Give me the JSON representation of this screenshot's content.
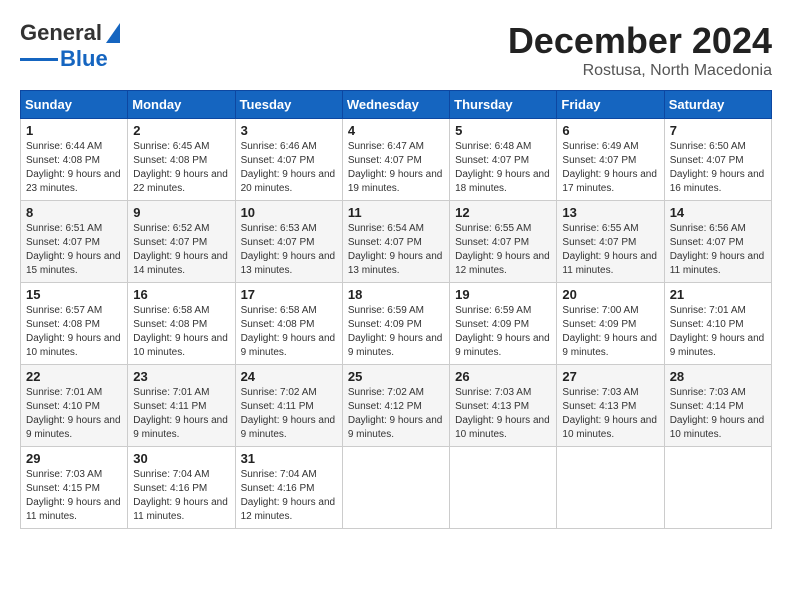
{
  "header": {
    "logo_general": "General",
    "logo_blue": "Blue",
    "month": "December 2024",
    "location": "Rostusa, North Macedonia"
  },
  "weekdays": [
    "Sunday",
    "Monday",
    "Tuesday",
    "Wednesday",
    "Thursday",
    "Friday",
    "Saturday"
  ],
  "weeks": [
    [
      {
        "day": "1",
        "sunrise": "6:44 AM",
        "sunset": "4:08 PM",
        "daylight": "9 hours and 23 minutes."
      },
      {
        "day": "2",
        "sunrise": "6:45 AM",
        "sunset": "4:08 PM",
        "daylight": "9 hours and 22 minutes."
      },
      {
        "day": "3",
        "sunrise": "6:46 AM",
        "sunset": "4:07 PM",
        "daylight": "9 hours and 20 minutes."
      },
      {
        "day": "4",
        "sunrise": "6:47 AM",
        "sunset": "4:07 PM",
        "daylight": "9 hours and 19 minutes."
      },
      {
        "day": "5",
        "sunrise": "6:48 AM",
        "sunset": "4:07 PM",
        "daylight": "9 hours and 18 minutes."
      },
      {
        "day": "6",
        "sunrise": "6:49 AM",
        "sunset": "4:07 PM",
        "daylight": "9 hours and 17 minutes."
      },
      {
        "day": "7",
        "sunrise": "6:50 AM",
        "sunset": "4:07 PM",
        "daylight": "9 hours and 16 minutes."
      }
    ],
    [
      {
        "day": "8",
        "sunrise": "6:51 AM",
        "sunset": "4:07 PM",
        "daylight": "9 hours and 15 minutes."
      },
      {
        "day": "9",
        "sunrise": "6:52 AM",
        "sunset": "4:07 PM",
        "daylight": "9 hours and 14 minutes."
      },
      {
        "day": "10",
        "sunrise": "6:53 AM",
        "sunset": "4:07 PM",
        "daylight": "9 hours and 13 minutes."
      },
      {
        "day": "11",
        "sunrise": "6:54 AM",
        "sunset": "4:07 PM",
        "daylight": "9 hours and 13 minutes."
      },
      {
        "day": "12",
        "sunrise": "6:55 AM",
        "sunset": "4:07 PM",
        "daylight": "9 hours and 12 minutes."
      },
      {
        "day": "13",
        "sunrise": "6:55 AM",
        "sunset": "4:07 PM",
        "daylight": "9 hours and 11 minutes."
      },
      {
        "day": "14",
        "sunrise": "6:56 AM",
        "sunset": "4:07 PM",
        "daylight": "9 hours and 11 minutes."
      }
    ],
    [
      {
        "day": "15",
        "sunrise": "6:57 AM",
        "sunset": "4:08 PM",
        "daylight": "9 hours and 10 minutes."
      },
      {
        "day": "16",
        "sunrise": "6:58 AM",
        "sunset": "4:08 PM",
        "daylight": "9 hours and 10 minutes."
      },
      {
        "day": "17",
        "sunrise": "6:58 AM",
        "sunset": "4:08 PM",
        "daylight": "9 hours and 9 minutes."
      },
      {
        "day": "18",
        "sunrise": "6:59 AM",
        "sunset": "4:09 PM",
        "daylight": "9 hours and 9 minutes."
      },
      {
        "day": "19",
        "sunrise": "6:59 AM",
        "sunset": "4:09 PM",
        "daylight": "9 hours and 9 minutes."
      },
      {
        "day": "20",
        "sunrise": "7:00 AM",
        "sunset": "4:09 PM",
        "daylight": "9 hours and 9 minutes."
      },
      {
        "day": "21",
        "sunrise": "7:01 AM",
        "sunset": "4:10 PM",
        "daylight": "9 hours and 9 minutes."
      }
    ],
    [
      {
        "day": "22",
        "sunrise": "7:01 AM",
        "sunset": "4:10 PM",
        "daylight": "9 hours and 9 minutes."
      },
      {
        "day": "23",
        "sunrise": "7:01 AM",
        "sunset": "4:11 PM",
        "daylight": "9 hours and 9 minutes."
      },
      {
        "day": "24",
        "sunrise": "7:02 AM",
        "sunset": "4:11 PM",
        "daylight": "9 hours and 9 minutes."
      },
      {
        "day": "25",
        "sunrise": "7:02 AM",
        "sunset": "4:12 PM",
        "daylight": "9 hours and 9 minutes."
      },
      {
        "day": "26",
        "sunrise": "7:03 AM",
        "sunset": "4:13 PM",
        "daylight": "9 hours and 10 minutes."
      },
      {
        "day": "27",
        "sunrise": "7:03 AM",
        "sunset": "4:13 PM",
        "daylight": "9 hours and 10 minutes."
      },
      {
        "day": "28",
        "sunrise": "7:03 AM",
        "sunset": "4:14 PM",
        "daylight": "9 hours and 10 minutes."
      }
    ],
    [
      {
        "day": "29",
        "sunrise": "7:03 AM",
        "sunset": "4:15 PM",
        "daylight": "9 hours and 11 minutes."
      },
      {
        "day": "30",
        "sunrise": "7:04 AM",
        "sunset": "4:16 PM",
        "daylight": "9 hours and 11 minutes."
      },
      {
        "day": "31",
        "sunrise": "7:04 AM",
        "sunset": "4:16 PM",
        "daylight": "9 hours and 12 minutes."
      },
      null,
      null,
      null,
      null
    ]
  ],
  "labels": {
    "sunrise": "Sunrise:",
    "sunset": "Sunset:",
    "daylight": "Daylight:"
  }
}
